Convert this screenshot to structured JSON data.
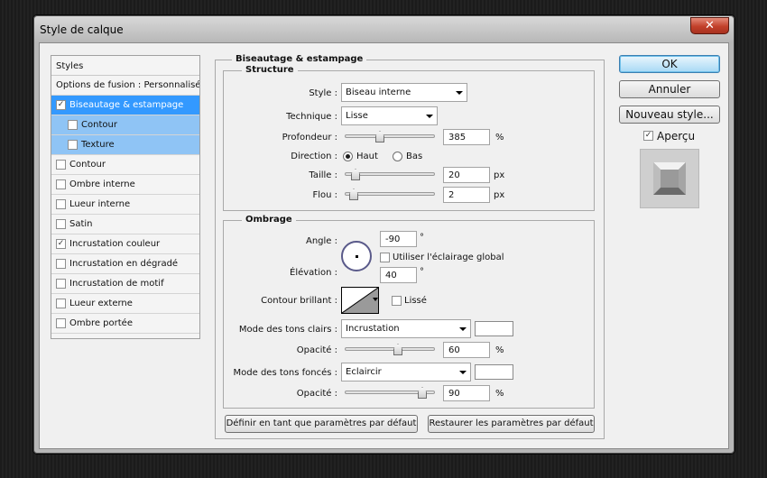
{
  "window": {
    "title": "Style de calque",
    "close_label": "✕"
  },
  "styles": {
    "header": "Styles",
    "items": [
      {
        "label": "Options de fusion : Personnalisé...",
        "checked": false
      },
      {
        "label": "Biseautage & estampage",
        "checked": true
      },
      {
        "label": "Contour",
        "checked": false
      },
      {
        "label": "Texture",
        "checked": false
      },
      {
        "label": "Contour",
        "checked": false
      },
      {
        "label": "Ombre interne",
        "checked": false
      },
      {
        "label": "Lueur interne",
        "checked": false
      },
      {
        "label": "Satin",
        "checked": false
      },
      {
        "label": "Incrustation couleur",
        "checked": true
      },
      {
        "label": "Incrustation en dégradé",
        "checked": false
      },
      {
        "label": "Incrustation de motif",
        "checked": false
      },
      {
        "label": "Lueur externe",
        "checked": false
      },
      {
        "label": "Ombre portée",
        "checked": false
      }
    ]
  },
  "bevel": {
    "title": "Biseautage & estampage",
    "structure": {
      "title": "Structure",
      "style_label": "Style :",
      "style_value": "Biseau interne",
      "technique_label": "Technique :",
      "technique_value": "Lisse",
      "depth_label": "Profondeur :",
      "depth_value": "385",
      "depth_unit": "%",
      "depth_level": 0.38,
      "direction_label": "Direction :",
      "dir_up": "Haut",
      "dir_down": "Bas",
      "direction": "Haut",
      "size_label": "Taille :",
      "size_value": "20",
      "size_unit": "px",
      "size_level": 0.08,
      "soften_label": "Flou :",
      "soften_value": "2",
      "soften_unit": "px",
      "soften_level": 0.06
    },
    "shading": {
      "title": "Ombrage",
      "angle_label": "Angle :",
      "angle_value": "-90",
      "angle_unit": "°",
      "global_light_label": "Utiliser l'éclairage global",
      "altitude_label": "Élévation :",
      "altitude_value": "40",
      "altitude_unit": "°",
      "gloss_label": "Contour brillant :",
      "smooth_label": "Lissé",
      "highlight_mode_label": "Mode des tons clairs :",
      "highlight_mode_value": "Incrustation",
      "highlight_color": "#ffffff",
      "highlight_opacity_label": "Opacité :",
      "highlight_opacity_value": "60",
      "highlight_opacity_unit": "%",
      "highlight_opacity_level": 0.6,
      "shadow_mode_label": "Mode des tons foncés :",
      "shadow_mode_value": "Eclaircir",
      "shadow_color": "#ffffff",
      "shadow_opacity_label": "Opacité :",
      "shadow_opacity_value": "90",
      "shadow_opacity_unit": "%",
      "shadow_opacity_level": 0.9
    },
    "make_default": "Définir en tant que paramètres par défaut",
    "reset_default": "Restaurer les paramètres par défaut"
  },
  "actions": {
    "ok": "OK",
    "cancel": "Annuler",
    "new_style": "Nouveau style...",
    "preview_label": "Aperçu",
    "preview_checked": true
  }
}
